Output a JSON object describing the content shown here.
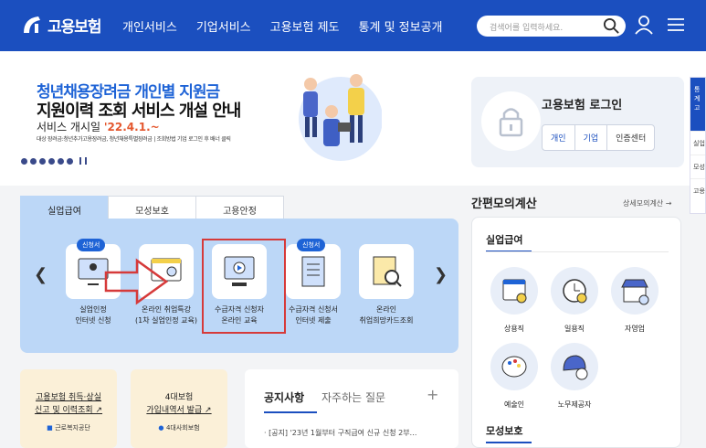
{
  "header": {
    "logo": "고용보험",
    "nav": [
      "개인서비스",
      "기업서비스",
      "고용보험 제도",
      "통계 및 정보공개"
    ],
    "search_placeholder": "검색어를 입력하세요."
  },
  "banner": {
    "line1": "청년채용장려금 개인별 지원금",
    "line2": "지원이력 조회 서비스 개설 안내",
    "line3": "서비스 개시일 ",
    "date": "'22.4.1.~",
    "fine": "대상 장려금:청년추가고용장려금, 청년채용특별장려금 | 조회방법 기업 로그인 후 배너 클릭"
  },
  "login": {
    "title": "고용보험 로그인",
    "buttons": [
      "개인",
      "기업",
      "인증센터"
    ]
  },
  "side": {
    "top": "통계 고",
    "items": [
      "실업",
      "모성",
      "고용"
    ]
  },
  "tabs": [
    "실업급여",
    "모성보호",
    "고용안정"
  ],
  "services": [
    {
      "badge": "신청서",
      "label1": "실업인정",
      "label2": "인터넷 신청"
    },
    {
      "badge": "",
      "label1": "온라인 취업특강",
      "label2": "(1차 실업인정 교육)"
    },
    {
      "badge": "",
      "label1": "수급자격 신청자",
      "label2": "온라인 교육"
    },
    {
      "badge": "신청서",
      "label1": "수급자격 신청서",
      "label2": "인터넷 제출"
    },
    {
      "badge": "",
      "label1": "온라인",
      "label2": "취업희망카드조회"
    }
  ],
  "simulator": {
    "title": "간편모의계산",
    "more": "상세모의계산 →",
    "section1": "실업급여",
    "items": [
      "상용직",
      "일용직",
      "자영업",
      "예술인",
      "노무제공자"
    ],
    "section2": "모성보호"
  },
  "cards": [
    {
      "line1": "고용보험 취득·상실",
      "line2": "신고 및 이력조회 ↗",
      "sub": "근로복지공단"
    },
    {
      "line1": "4대보험",
      "line2": "가입내역서 발급 ↗",
      "sub": "4대사회보험"
    }
  ],
  "notice": {
    "tab1": "공지사항",
    "tab2": "자주하는 질문",
    "plus": "+",
    "item": "[공지] '23년 1월부터 구직급여 신규 신청 2부…"
  },
  "colors": {
    "primary": "#1b4fbf",
    "panel": "#bcd7f7",
    "highlight": "#d63a3a"
  }
}
